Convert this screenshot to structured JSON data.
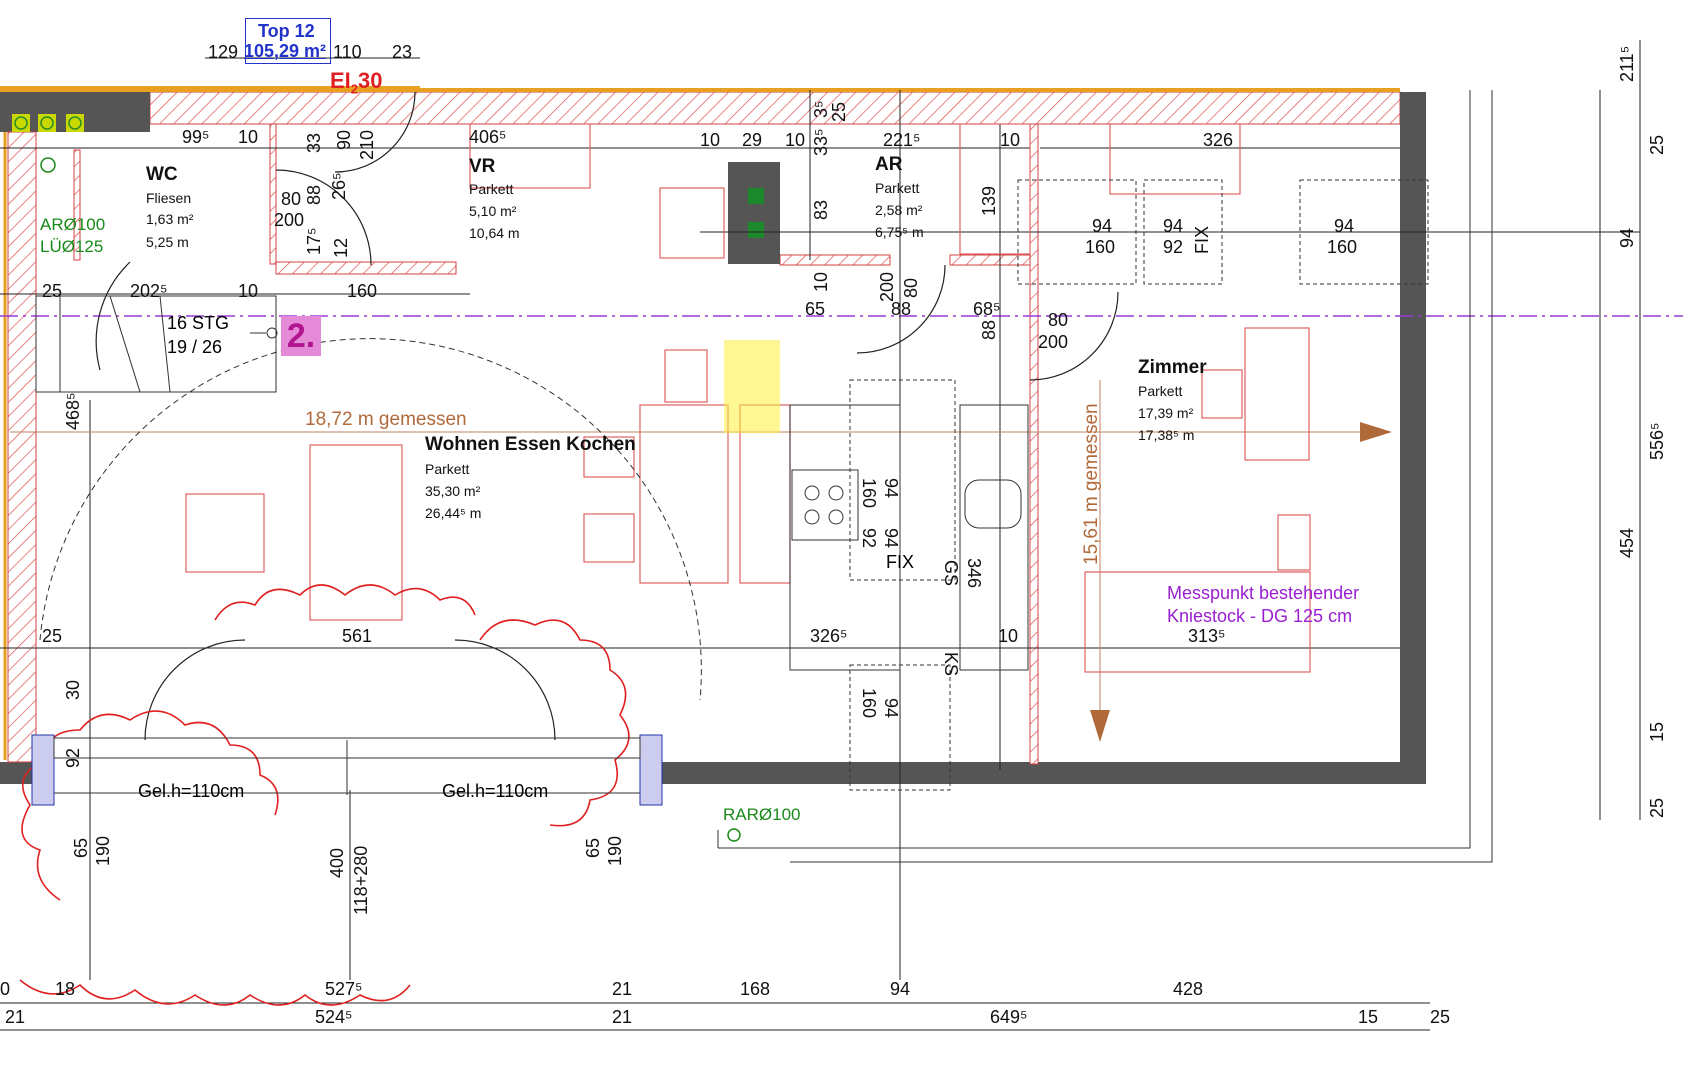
{
  "header": {
    "unit_title": "Top 12",
    "unit_area": "105,29 m²",
    "fire_rating": "EI",
    "fire_rating_sub": "2",
    "fire_rating_val": "30",
    "top_dim_left": "129",
    "top_dim_right": "110",
    "top_dim_far": "23"
  },
  "rooms": {
    "wc": {
      "name": "WC",
      "floor": "Fliesen",
      "area": "1,63 m²",
      "perimeter": "5,25 m"
    },
    "vr": {
      "name": "VR",
      "floor": "Parkett",
      "area": "5,10 m²",
      "perimeter": "10,64 m"
    },
    "ar": {
      "name": "AR",
      "floor": "Parkett",
      "area": "2,58 m²",
      "perimeter": "6,75⁵ m"
    },
    "wek": {
      "name": "Wohnen Essen Kochen",
      "floor": "Parkett",
      "area": "35,30 m²",
      "perimeter": "26,44⁵ m"
    },
    "zimmer": {
      "name": "Zimmer",
      "floor": "Parkett",
      "area": "17,39 m²",
      "perimeter": "17,38⁵ m"
    }
  },
  "annotations": {
    "ar_o100": "ARØ100",
    "lu_o125": "LÜØ125",
    "rar_o100": "RARØ100",
    "stairs_1": "16 STG",
    "stairs_2": "19 / 26",
    "stair_mark": "2.",
    "measured_h": "18,72 m gemessen",
    "measured_v": "15,61 m gemessen",
    "messpunkt_1": "Messpunkt bestehender",
    "messpunkt_2": "Kniestock - DG 125 cm",
    "gelh_left": "Gel.h=110cm",
    "gelh_right": "Gel.h=110cm",
    "fix_1": "FIX",
    "fix_2": "FIX",
    "gs": "GS",
    "ks": "KS"
  },
  "dims": {
    "d99": "99⁵",
    "d10a": "10",
    "d33": "33",
    "d90": "90",
    "d210": "210",
    "d4065": "406⁵",
    "d10b": "10",
    "d29": "29",
    "d10c": "10",
    "d335": "33⁵",
    "d2215": "221⁵",
    "d10d": "10",
    "d326": "326",
    "d35": "3⁵",
    "d25v": "25",
    "d80a": "80",
    "d88a": "88",
    "d265": "26⁵",
    "d200a": "200",
    "d175": "17⁵",
    "d12": "12",
    "d83": "83",
    "d139": "139",
    "w94a": "94",
    "w160a": "160",
    "w94b": "94",
    "w92a": "92",
    "w94c": "94",
    "w160b": "160",
    "d25a": "25",
    "d2025": "202⁵",
    "d10e": "10",
    "d160": "160",
    "d10f": "10",
    "d65": "65",
    "d200b": "200",
    "d80b": "80",
    "d88b": "88",
    "d685": "68⁵",
    "d88c": "88",
    "d80c": "80",
    "d200c": "200",
    "d4685": "468⁵",
    "k94a": "94",
    "k160a": "160",
    "k94b": "94",
    "k92b": "92",
    "d346": "346",
    "d25b": "25",
    "d561": "561",
    "d3265": "326⁵",
    "d10g": "10",
    "d3135": "313⁵",
    "d30": "30",
    "d92": "92",
    "k94c": "94",
    "k160b": "160",
    "d65a": "65",
    "d190a": "190",
    "d400": "400",
    "d118": "118+280",
    "d65b": "65",
    "d190b": "190",
    "b0": "0",
    "b18": "18",
    "b5275": "527⁵",
    "b21a": "21",
    "b168": "168",
    "b94": "94",
    "b428": "428",
    "c21": "21",
    "c5245": "524⁵",
    "c21b": "21",
    "c6495": "649⁵",
    "c15": "15",
    "c25": "25",
    "r2115": "211⁵",
    "r25a": "25",
    "r94": "94",
    "r5565": "556⁵",
    "r454": "454",
    "r15": "15",
    "r25b": "25"
  }
}
